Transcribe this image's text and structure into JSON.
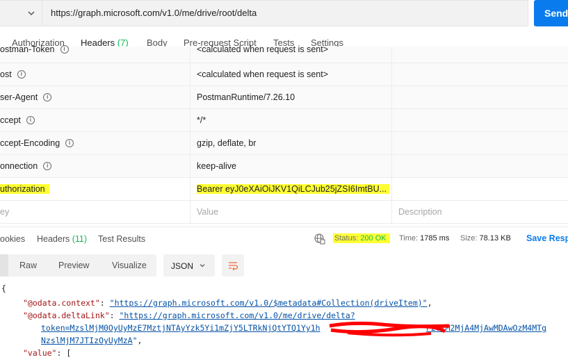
{
  "request": {
    "url": "https://graph.microsoft.com/v1.0/me/drive/root/delta",
    "send_label": "Send"
  },
  "request_tabs": {
    "authorization": "Authorization",
    "headers": "Headers",
    "headers_count": "(7)",
    "body": "Body",
    "pre_request": "Pre-request Script",
    "tests": "Tests",
    "settings": "Settings"
  },
  "headers_table": {
    "rows": [
      {
        "key": "ostman-Token",
        "value": "<calculated when request is sent>"
      },
      {
        "key": "ost",
        "value": "<calculated when request is sent>"
      },
      {
        "key": "ser-Agent",
        "value": "PostmanRuntime/7.26.10"
      },
      {
        "key": "ccept",
        "value": "*/*"
      },
      {
        "key": "ccept-Encoding",
        "value": "gzip, deflate, br"
      },
      {
        "key": "onnection",
        "value": "keep-alive"
      },
      {
        "key": "uthorization",
        "value": "Bearer eyJ0eXAiOiJKV1QiLCJub25jZSI6ImtBU..."
      }
    ],
    "new_row": {
      "key_placeholder": "ey",
      "value_placeholder": "Value",
      "description_placeholder": "Description"
    }
  },
  "response_tabs": {
    "cookies": "ookies",
    "headers": "Headers",
    "headers_count": "(11)",
    "test_results": "Test Results"
  },
  "response_meta": {
    "status_label": "Status:",
    "status_value": "200 OK",
    "time_label": "Time:",
    "time_value": "1785 ms",
    "size_label": "Size:",
    "size_value": "78.13 KB",
    "save_label": "Save Resp"
  },
  "body_toolbar": {
    "modes": [
      "Raw",
      "Preview",
      "Visualize"
    ],
    "format": "JSON"
  },
  "response_body": {
    "open_brace": "{",
    "context_key": "\"@odata.context\"",
    "context_value": "\"https://graph.microsoft.com/v1.0/$metadata#Collection(driveItem)\"",
    "delta_key": "\"@odata.deltaLink\"",
    "delta_value_line1": "\"https://graph.microsoft.com/v1.0/me/drive/delta?",
    "delta_value_line2_start": "token=MzslMjM0OyUyMzE7MztjNTAyYzk5Yi1mZjY5LTRkNjQtYTQ1Yy1h",
    "delta_value_line2_end": "F2OTM2MjA4MjAwMDAwOzM4MTg",
    "delta_value_line3": "NzslMjM7JTIzOyUyMzA",
    "value_key": "\"value\"",
    "value_open": "["
  },
  "colors": {
    "send_button": "#097bed",
    "active_tab_underline": "#f26b3a",
    "count_green": "#0cbb52",
    "highlight_yellow": "#ffff33",
    "redaction_red": "#ff0000"
  }
}
